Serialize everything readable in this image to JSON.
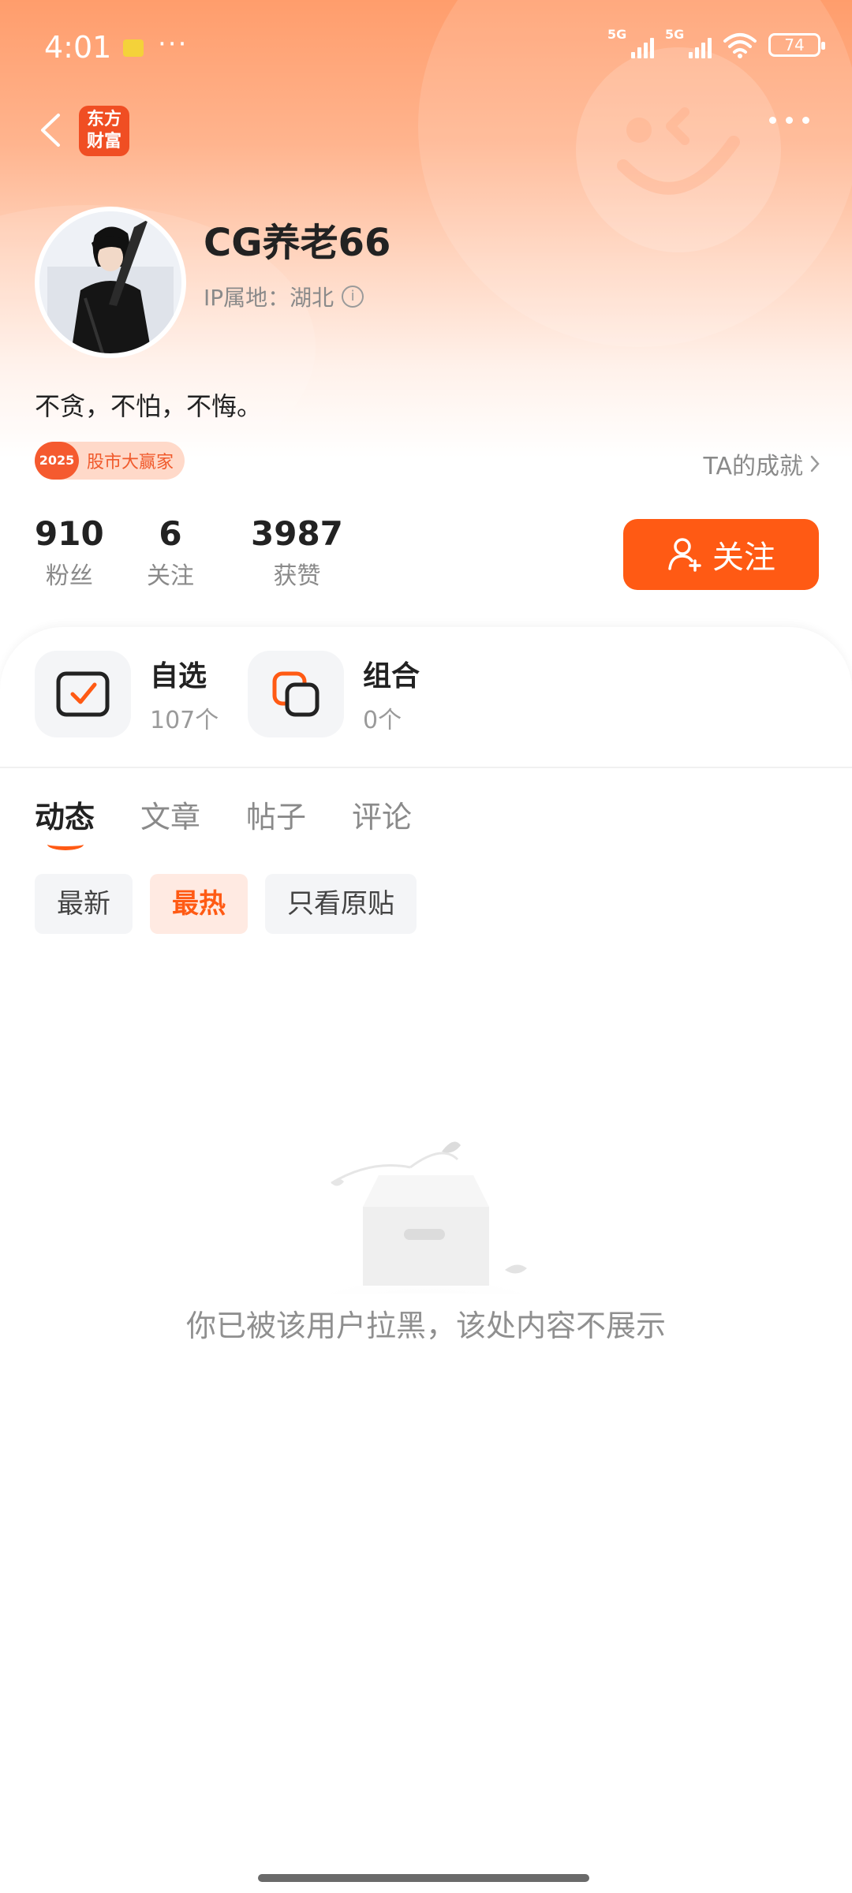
{
  "status_bar": {
    "time": "4:01",
    "dots": "···",
    "network1": "5G",
    "network2": "5G",
    "battery": "74"
  },
  "nav": {
    "logo_line1": "东方",
    "logo_line2": "财富"
  },
  "profile": {
    "username": "CG养老66",
    "ip_location": "IP属地：湖北",
    "bio": "不贪，不怕，不悔。",
    "badge_year": "2025",
    "badge_text": "股市大赢家",
    "achievements_link": "TA的成就"
  },
  "stats": {
    "fans_num": "910",
    "fans_label": "粉丝",
    "following_num": "6",
    "following_label": "关注",
    "likes_num": "3987",
    "likes_label": "获赞"
  },
  "follow_button": "关注",
  "features": {
    "watchlist_title": "自选",
    "watchlist_count": "107个",
    "portfolio_title": "组合",
    "portfolio_count": "0个"
  },
  "tabs": [
    "动态",
    "文章",
    "帖子",
    "评论"
  ],
  "filters": [
    "最新",
    "最热",
    "只看原贴"
  ],
  "empty_message": "你已被该用户拉黑，该处内容不展示",
  "colors": {
    "accent": "#ff5a14",
    "hero_top": "#ff9d6c"
  }
}
